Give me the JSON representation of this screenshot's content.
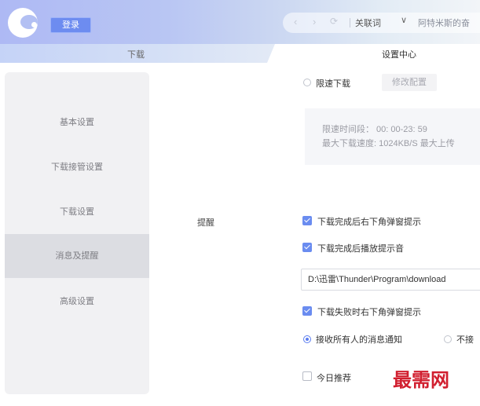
{
  "header": {
    "login_label": "登录",
    "nav_back": "‹",
    "nav_forward": "›",
    "refresh": "⟳",
    "search_mode": "关联词",
    "search_mode_caret": "∨",
    "search_text": "阿特米斯的奋"
  },
  "tabs": [
    {
      "label": "下载"
    },
    {
      "label": "设置中心"
    }
  ],
  "sidebar": {
    "items": [
      {
        "label": "基本设置"
      },
      {
        "label": "下载接管设置"
      },
      {
        "label": "下载设置"
      },
      {
        "label": "消息及提醒"
      },
      {
        "label": "高级设置"
      }
    ]
  },
  "speed_limit": {
    "label": "限速下载",
    "modify_label": "修改配置",
    "time_range": "限速时间段：  00: 00-23: 59",
    "max_speed": "最大下载速度: 1024KB/S    最大上传"
  },
  "reminder": {
    "section_label": "提醒",
    "options": {
      "download_done_popup": "下载完成后右下角弹窗提示",
      "download_done_sound": "下载完成后播放提示音",
      "sound_path": "D:\\迅雷\\Thunder\\Program\\download",
      "download_fail_popup": "下载失败时右下角弹窗提示",
      "receive_all": "接收所有人的消息通知",
      "receive_none": "不接",
      "today_recommend": "今日推荐"
    }
  },
  "watermark": "最需网",
  "colors": {
    "accent": "#6a8cf0",
    "watermark": "#d11f2f"
  }
}
